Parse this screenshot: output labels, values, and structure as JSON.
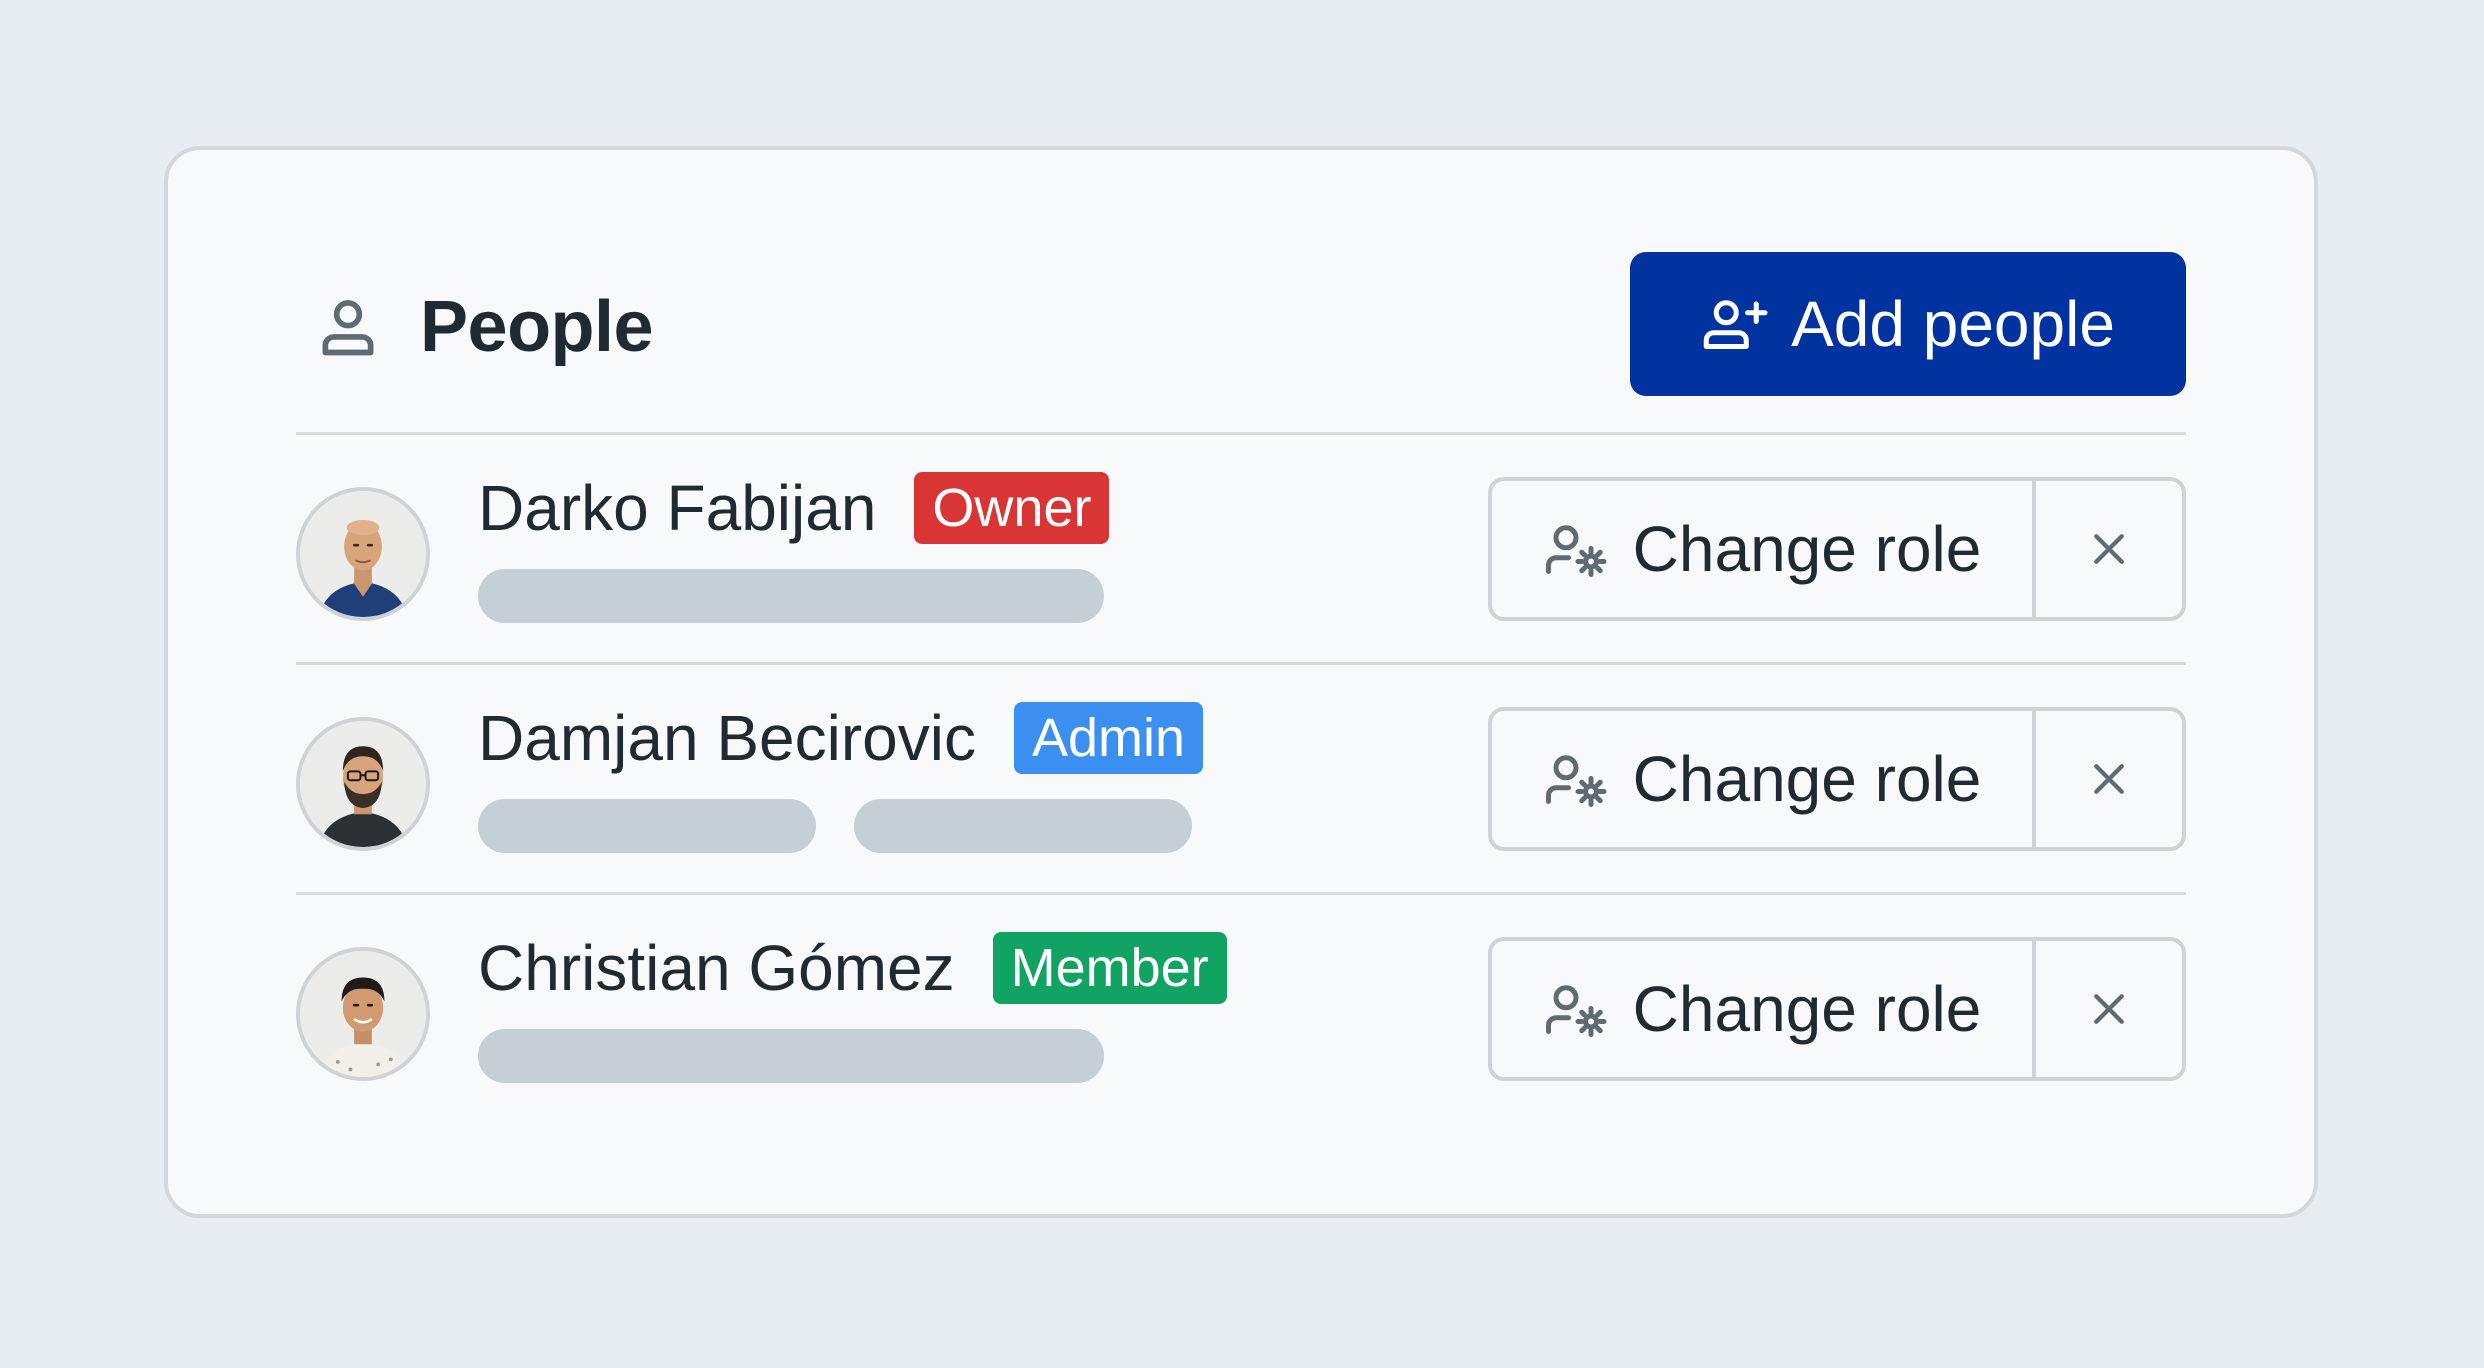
{
  "header": {
    "title": "People",
    "title_icon": "person-icon",
    "add_button_label": "Add people",
    "add_button_icon": "person-add-icon"
  },
  "colors": {
    "primary": "#0033a0",
    "owner": "#d93535",
    "admin": "#3a8ff0",
    "member": "#10a362",
    "placeholder": "#c4cfd6"
  },
  "people": [
    {
      "name": "Darko Fabijan",
      "role": "Owner",
      "role_color": "#d93535",
      "placeholder_count": 1
    },
    {
      "name": "Damjan Becirovic",
      "role": "Admin",
      "role_color": "#3a8ff0",
      "placeholder_count": 2
    },
    {
      "name": "Christian Gómez",
      "role": "Member",
      "role_color": "#10a362",
      "placeholder_count": 1
    }
  ],
  "row_actions": {
    "change_role_label": "Change role",
    "change_role_icon": "user-gear-icon",
    "remove_icon": "close-icon"
  }
}
